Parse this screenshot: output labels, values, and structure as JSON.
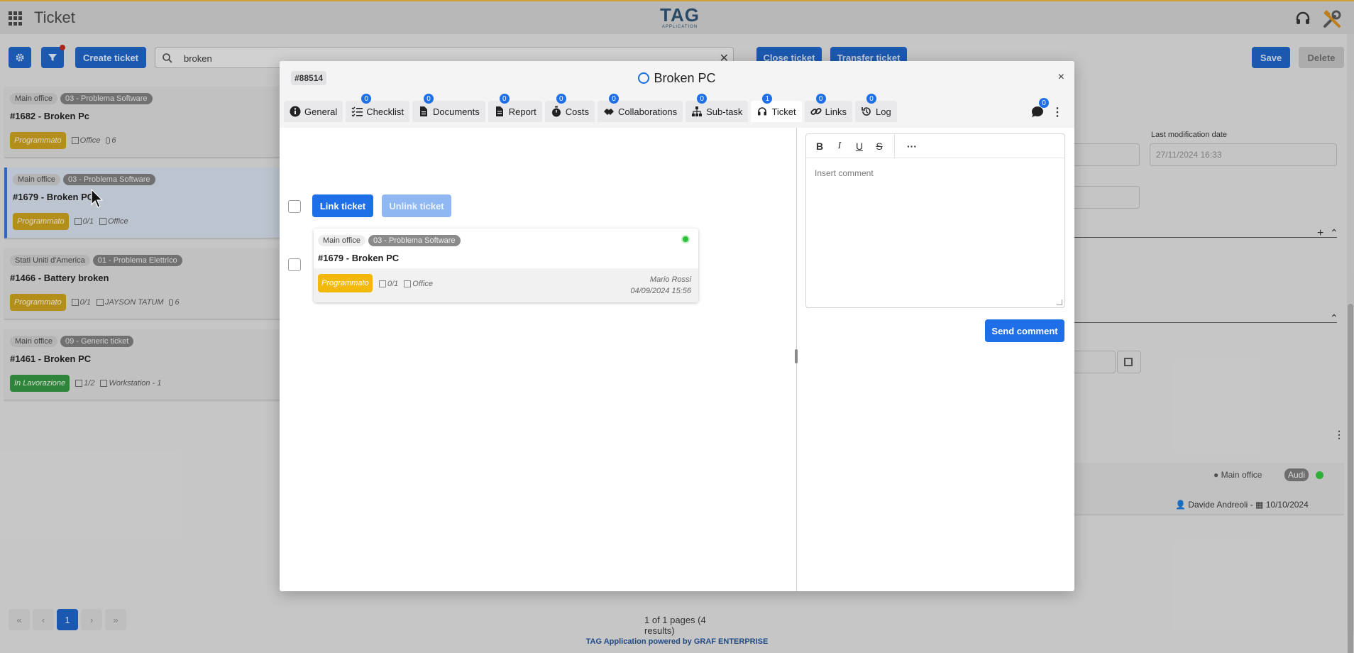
{
  "app": {
    "title": "Ticket",
    "logo_main": "TAG",
    "logo_sub": "APPLICATION"
  },
  "toolbar": {
    "create_label": "Create ticket",
    "search_value": "broken",
    "search_placeholder": "Search"
  },
  "tickets": [
    {
      "location": "Main office",
      "category": "03 - Problema Software",
      "title": "#1682 - Broken Pc",
      "status": "Programmato",
      "meta1": "Office",
      "meta2": "6"
    },
    {
      "location": "Main office",
      "category": "03 - Problema Software",
      "title": "#1679 - Broken PC",
      "status": "Programmato",
      "meta1": "0/1",
      "meta2": "Office"
    },
    {
      "location": "Stati Uniti d'America",
      "category": "01 - Problema Elettrico",
      "title": "#1466 - Battery broken",
      "status": "Programmato",
      "meta1": "0/1",
      "meta2": "JAYSON TATUM",
      "meta3": "6"
    },
    {
      "location": "Main office",
      "category": "09 - Generic ticket",
      "title": "#1461 - Broken PC",
      "status": "In Lavorazione",
      "meta1": "1/2",
      "meta2": "Workstation - 1"
    }
  ],
  "pagination": {
    "current_page": "1",
    "results": "1 of 1 pages (4 results)"
  },
  "footer": "TAG Application powered by GRAF ENTERPRISE",
  "detail": {
    "close_label": "Close ticket",
    "transfer_label": "Transfer ticket",
    "save_label": "Save",
    "delete_label": "Delete",
    "last_mod_label": "Last modification date",
    "last_mod_value": "27/11/2024 16:33",
    "assigned_location": "Main office",
    "assigned_tag": "Audi",
    "assigned_user": "Davide Andreoli",
    "assigned_date": "10/10/2024"
  },
  "modal": {
    "ticket_id": "#88514",
    "title": "Broken PC",
    "chat_count": "0",
    "tabs": [
      {
        "label": "General",
        "icon": "info-icon",
        "badge": ""
      },
      {
        "label": "Checklist",
        "icon": "checklist-icon",
        "badge": "0"
      },
      {
        "label": "Documents",
        "icon": "document-icon",
        "badge": "0"
      },
      {
        "label": "Report",
        "icon": "report-icon",
        "badge": "0"
      },
      {
        "label": "Costs",
        "icon": "stopwatch-icon",
        "badge": "0"
      },
      {
        "label": "Collaborations",
        "icon": "handshake-icon",
        "badge": "0"
      },
      {
        "label": "Sub-task",
        "icon": "hierarchy-icon",
        "badge": "0"
      },
      {
        "label": "Ticket",
        "icon": "headset-icon",
        "badge": "1"
      },
      {
        "label": "Links",
        "icon": "link-icon",
        "badge": "0"
      },
      {
        "label": "Log",
        "icon": "history-icon",
        "badge": "0"
      }
    ],
    "link_label": "Link ticket",
    "unlink_label": "Unlink ticket",
    "linked": {
      "location": "Main office",
      "category": "03 - Problema Software",
      "title": "#1679 - Broken PC",
      "status": "Programmato",
      "checklist": "0/1",
      "asset": "Office",
      "user": "Mario Rossi",
      "date": "04/09/2024 15:56"
    },
    "editor": {
      "bold": "B",
      "italic": "I",
      "underline": "U",
      "strike": "S",
      "more": "···",
      "placeholder": "Insert comment"
    },
    "send_label": "Send comment",
    "close": "×"
  },
  "colors": {
    "primary": "#1f6fe8",
    "status_programmato": "#f2b90b",
    "status_lavorazione": "#2f8f3a",
    "online": "#2fbf3a"
  }
}
